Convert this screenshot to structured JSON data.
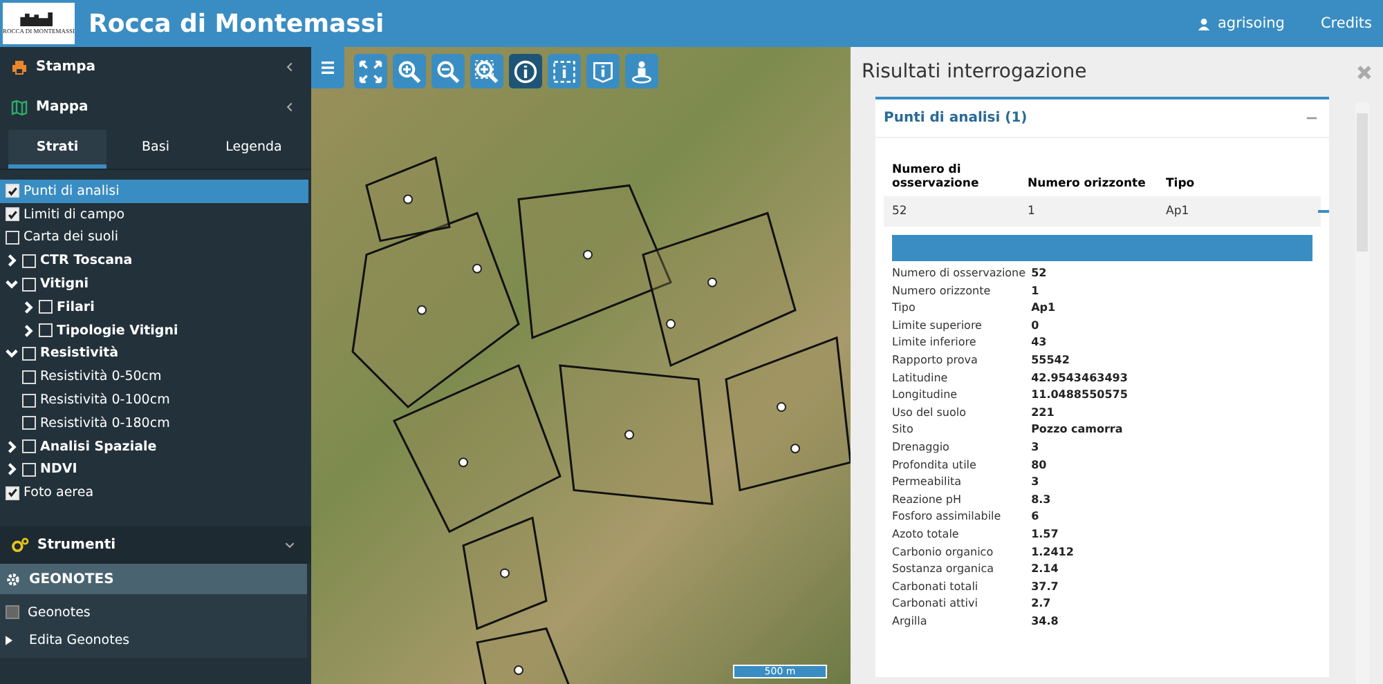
{
  "header": {
    "logo_text": "ROCCA DI MONTEMASSI",
    "title": "Rocca di Montemassi",
    "user": "agrisoing",
    "credits": "Credits"
  },
  "sidebar": {
    "sections": [
      {
        "label": "Stampa",
        "expanded": false
      },
      {
        "label": "Mappa",
        "expanded": false
      }
    ],
    "tabs": [
      {
        "label": "Strati",
        "selected": true
      },
      {
        "label": "Basi",
        "selected": false
      },
      {
        "label": "Legenda",
        "selected": false
      }
    ],
    "layers": [
      {
        "label": "Punti di analisi",
        "kind": "layer",
        "checked": true,
        "selected": true
      },
      {
        "label": "Limiti di campo",
        "kind": "layer",
        "checked": true,
        "selected": false
      },
      {
        "label": "Carta dei suoli",
        "kind": "layer",
        "checked": false,
        "selected": false
      },
      {
        "label": "CTR Toscana",
        "kind": "group",
        "checked": false,
        "selected": false,
        "expanded": false
      },
      {
        "label": "Vitigni",
        "kind": "group",
        "checked": false,
        "selected": false,
        "expanded": true,
        "children": [
          {
            "label": "Filari",
            "kind": "group",
            "checked": false,
            "selected": false,
            "expanded": false
          },
          {
            "label": "Tipologie Vitigni",
            "kind": "group",
            "checked": false,
            "selected": false,
            "expanded": false
          }
        ]
      },
      {
        "label": "Resistività",
        "kind": "group",
        "checked": false,
        "selected": false,
        "expanded": true,
        "children": [
          {
            "label": "Resistività 0-50cm",
            "kind": "layer",
            "checked": false,
            "selected": false
          },
          {
            "label": "Resistività 0-100cm",
            "kind": "layer",
            "checked": false,
            "selected": false
          },
          {
            "label": "Resistività 0-180cm",
            "kind": "layer",
            "checked": false,
            "selected": false
          }
        ]
      },
      {
        "label": "Analisi Spaziale",
        "kind": "group",
        "checked": false,
        "selected": false,
        "expanded": false
      },
      {
        "label": "NDVI",
        "kind": "group",
        "checked": false,
        "selected": false,
        "expanded": false
      },
      {
        "label": "Foto aerea",
        "kind": "layer",
        "checked": true,
        "selected": false
      }
    ],
    "tools": {
      "label": "Strumenti",
      "expanded": true
    },
    "geonotes": {
      "label": "GEONOTES",
      "items": [
        {
          "label": "Geonotes",
          "kind": "checkbox",
          "checked": false
        },
        {
          "label": "Edita Geonotes",
          "kind": "submenu"
        }
      ]
    }
  },
  "map": {
    "tools": [
      {
        "selected": false
      },
      {
        "selected": false
      },
      {
        "selected": false
      },
      {
        "selected": false
      },
      {
        "selected": false
      },
      {
        "selected": true
      },
      {
        "selected": false
      },
      {
        "selected": false
      },
      {
        "selected": false
      }
    ],
    "scale": "500 m"
  },
  "results": {
    "title": "Risultati interrogazione",
    "group": {
      "title": "Punti di analisi (1)",
      "expanded": true
    },
    "columns": [
      "Numero di osservazione",
      "Numero orizzonte",
      "Tipo"
    ],
    "rows": [
      {
        "cells": [
          "52",
          "1",
          "Ap1"
        ],
        "expanded": true
      }
    ],
    "details": [
      [
        "Numero di osservazione",
        "52"
      ],
      [
        "Numero orizzonte",
        "1"
      ],
      [
        "Tipo",
        "Ap1"
      ],
      [
        "Limite superiore",
        "0"
      ],
      [
        "Limite inferiore",
        "43"
      ],
      [
        "Rapporto prova",
        "55542"
      ],
      [
        "Latitudine",
        "42.9543463493"
      ],
      [
        "Longitudine",
        "11.0488550575"
      ],
      [
        "Uso del suolo",
        "221"
      ],
      [
        "Sito",
        "Pozzo camorra"
      ],
      [
        "Drenaggio",
        "3"
      ],
      [
        "Profondita utile",
        "80"
      ],
      [
        "Permeabilita",
        "3"
      ],
      [
        "Reazione pH",
        "8.3"
      ],
      [
        "Fosforo assimilabile",
        "6"
      ],
      [
        "Azoto totale",
        "1.57"
      ],
      [
        "Carbonio organico",
        "1.2412"
      ],
      [
        "Sostanza organica",
        "2.14"
      ],
      [
        "Carbonati totali",
        "37.7"
      ],
      [
        "Carbonati attivi",
        "2.7"
      ],
      [
        "Argilla",
        "34.8"
      ]
    ]
  }
}
